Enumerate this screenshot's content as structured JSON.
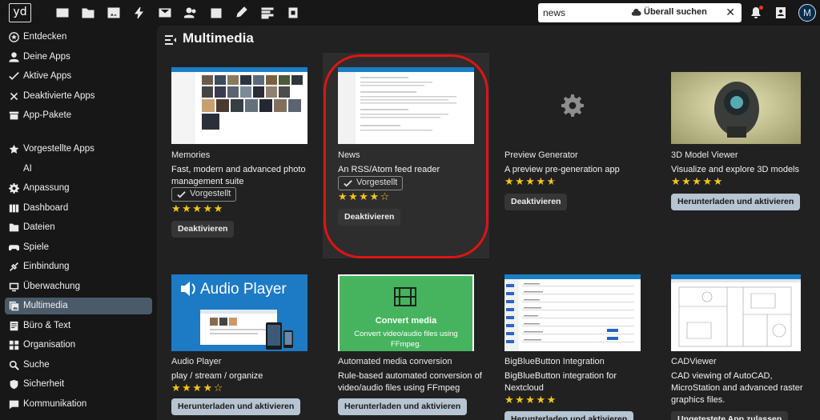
{
  "topbar": {
    "logo_text": "yd",
    "apps": [
      "dashboard-icon",
      "files-icon",
      "photos-icon",
      "activity-icon",
      "mail-icon",
      "contacts-icon",
      "calendar-icon",
      "notes-icon",
      "news-icon",
      "deck-icon"
    ],
    "search": {
      "value": "news",
      "global_label": "Überall suchen",
      "clear": "✕"
    },
    "avatar_letter": "M"
  },
  "sidebar": {
    "items": [
      {
        "label": "Entdecken",
        "icon": "star-circle-icon"
      },
      {
        "label": "Deine Apps",
        "icon": "account-icon"
      },
      {
        "label": "Aktive Apps",
        "icon": "check-icon"
      },
      {
        "label": "Deaktivierte Apps",
        "icon": "close-icon"
      },
      {
        "label": "App-Pakete",
        "icon": "package-icon"
      },
      {
        "label": "Vorgestellte Apps",
        "icon": "star-icon"
      },
      {
        "label": "AI",
        "icon": ""
      },
      {
        "label": "Anpassung",
        "icon": "cog-icon"
      },
      {
        "label": "Dashboard",
        "icon": "dashboard-icon"
      },
      {
        "label": "Dateien",
        "icon": "folder-icon"
      },
      {
        "label": "Spiele",
        "icon": "gamepad-icon"
      },
      {
        "label": "Einbindung",
        "icon": "connection-icon"
      },
      {
        "label": "Überwachung",
        "icon": "monitor-icon"
      },
      {
        "label": "Multimedia",
        "icon": "multimedia-icon",
        "active": true
      },
      {
        "label": "Büro & Text",
        "icon": "office-icon"
      },
      {
        "label": "Organisation",
        "icon": "organization-icon"
      },
      {
        "label": "Suche",
        "icon": "search-icon"
      },
      {
        "label": "Sicherheit",
        "icon": "shield-icon"
      },
      {
        "label": "Kommunikation",
        "icon": "chat-icon"
      }
    ]
  },
  "main": {
    "title": "Multimedia",
    "apps": [
      {
        "name": "Memories",
        "desc": "Fast, modern and advanced photo management suite",
        "featured": "Vorgestellt",
        "rating": 5,
        "button": "Deaktivieren"
      },
      {
        "name": "News",
        "desc": "An RSS/Atom feed reader",
        "featured": "Vorgestellt",
        "rating": 4,
        "button": "Deaktivieren"
      },
      {
        "name": "Preview Generator",
        "desc": "A preview pre-generation app",
        "rating": 4.5,
        "button": "Deaktivieren"
      },
      {
        "name": "3D Model Viewer",
        "desc": "Visualize and explore 3D models",
        "rating": 5,
        "button": "Herunterladen und aktivieren"
      },
      {
        "name": "Audio Player",
        "desc": "play / stream / organize",
        "rating": 4,
        "button": "Herunterladen und aktivieren",
        "thumb_title": "Audio Player"
      },
      {
        "name": "Automated media conversion",
        "desc": "Rule-based automated conversion of video/audio files using FFmpeg",
        "rating": 0,
        "button": "Herunterladen und aktivieren",
        "thumb_title": "Convert media",
        "thumb_sub": "Convert video/audio files using FFmpeg."
      },
      {
        "name": "BigBlueButton Integration",
        "desc": "BigBlueButton integration for Nextcloud",
        "rating": 5,
        "button": "Herunterladen und aktivieren"
      },
      {
        "name": "CADViewer",
        "desc": "CAD viewing of AutoCAD, MicroStation and advanced raster graphics files.",
        "rating": 0,
        "button": "Ungetestete App zulassen"
      }
    ]
  },
  "colors": {
    "accent_ring": "#e01414",
    "active_nav": "#4b5a69",
    "star": "#f5c518"
  }
}
